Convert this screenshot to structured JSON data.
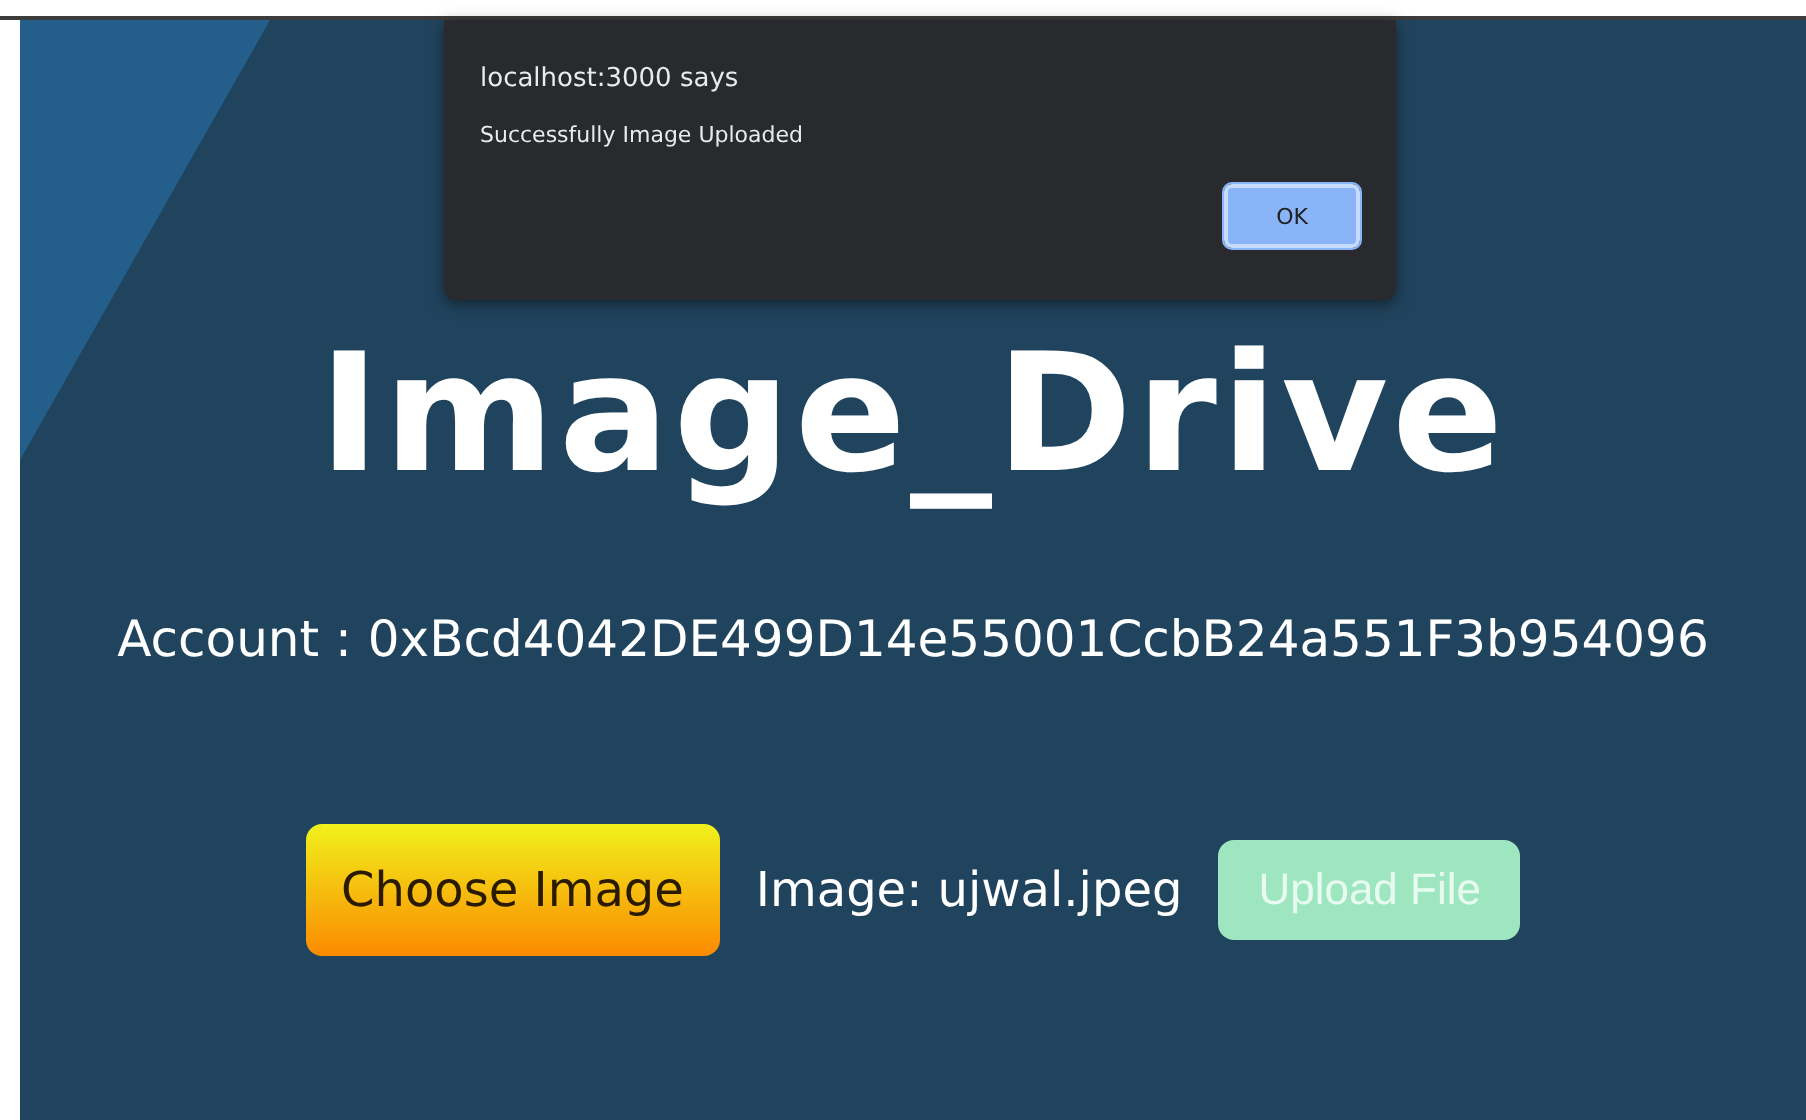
{
  "dialog": {
    "title": "localhost:3000 says",
    "message": "Successfully Image Uploaded",
    "button": "OK"
  },
  "app": {
    "title": "Image_Drive",
    "account": "Account : 0xBcd4042DE499D14e55001CcbB24a551F3b954096",
    "choose_button": "Choose Image",
    "file_label": "Image: ujwal.jpeg",
    "upload_button": {
      "label": "Upload File",
      "disabled": true
    }
  }
}
